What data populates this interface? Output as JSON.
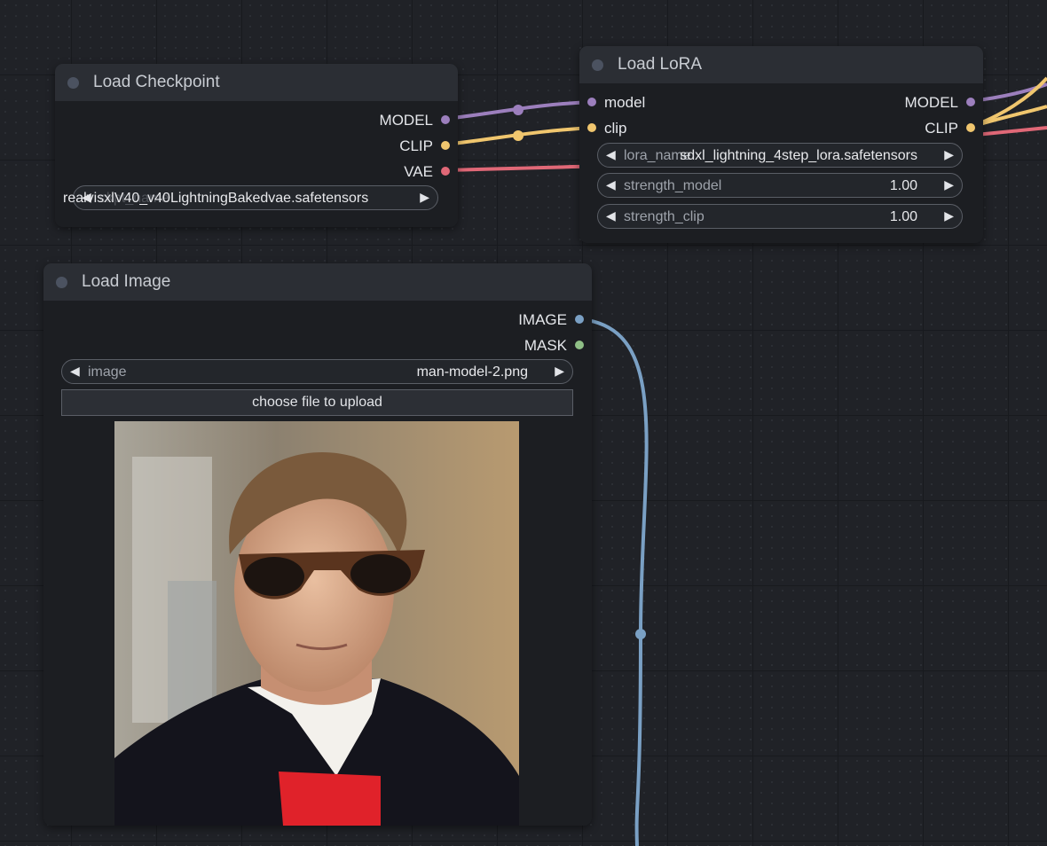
{
  "nodes": {
    "load_checkpoint": {
      "title": "Load Checkpoint",
      "outputs": [
        "MODEL",
        "CLIP",
        "VAE"
      ],
      "widget": {
        "label": "ckpt_name",
        "value": "realvisxlV40_v40LightningBakedvae.safetensors"
      }
    },
    "load_lora": {
      "title": "Load LoRA",
      "inputs": [
        "model",
        "clip"
      ],
      "outputs": [
        "MODEL",
        "CLIP"
      ],
      "widgets": [
        {
          "label": "lora_name",
          "value": "sdxl_lightning_4step_lora.safetensors"
        },
        {
          "label": "strength_model",
          "value": "1.00"
        },
        {
          "label": "strength_clip",
          "value": "1.00"
        }
      ]
    },
    "load_image": {
      "title": "Load Image",
      "outputs": [
        "IMAGE",
        "MASK"
      ],
      "widget": {
        "label": "image",
        "value": "man-model-2.png"
      },
      "upload_label": "choose file to upload"
    }
  },
  "colors": {
    "model": "#9c7fbd",
    "clip": "#f0c66e",
    "vae": "#e06877",
    "image": "#7aa0c4",
    "mask": "#8fbf86"
  },
  "icons": {
    "left_arrow": "◀",
    "right_arrow": "▶"
  }
}
